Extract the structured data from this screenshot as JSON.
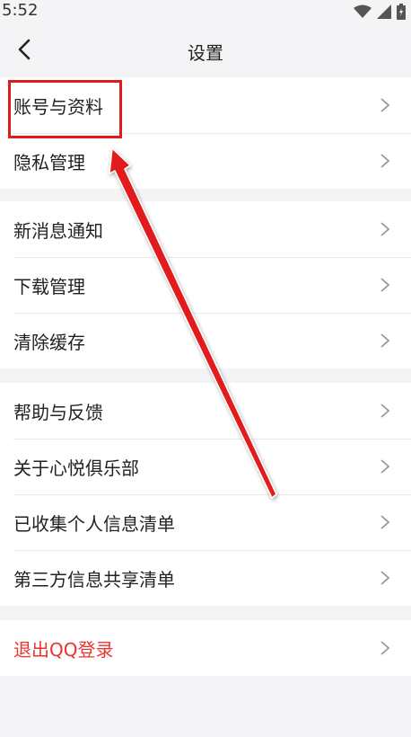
{
  "status_bar": {
    "time": "5:52"
  },
  "nav": {
    "title": "设置"
  },
  "groups": [
    {
      "items": [
        {
          "label": "账号与资料"
        },
        {
          "label": "隐私管理"
        }
      ]
    },
    {
      "items": [
        {
          "label": "新消息通知"
        },
        {
          "label": "下载管理"
        },
        {
          "label": "清除缓存"
        }
      ]
    },
    {
      "items": [
        {
          "label": "帮助与反馈"
        },
        {
          "label": "关于心悦俱乐部"
        },
        {
          "label": "已收集个人信息清单"
        },
        {
          "label": "第三方信息共享清单"
        }
      ]
    },
    {
      "items": [
        {
          "label": "退出QQ登录"
        }
      ]
    }
  ],
  "colors": {
    "danger": "#e8352f",
    "annotation": "#e21a1a",
    "background": "#f4f4f6"
  },
  "icons": [
    "back-arrow-icon",
    "chevron-right-icon",
    "wifi-icon",
    "signal-icon",
    "battery-icon"
  ]
}
